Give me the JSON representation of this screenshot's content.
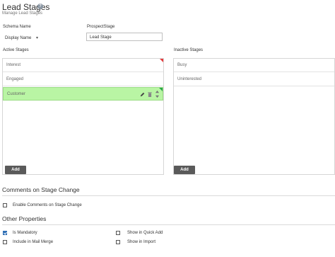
{
  "header": {
    "title": "Lead Stages",
    "subtitle": "Manage Lead Stages",
    "help_icon": "?"
  },
  "schema": {
    "label": "Schema Name",
    "value": "ProspectStage"
  },
  "display": {
    "label": "Display Name",
    "arrow": "▾",
    "value": "Lead Stage"
  },
  "active_stages": {
    "title": "Active Stages",
    "items": [
      {
        "label": "Interest"
      },
      {
        "label": "Engaged"
      },
      {
        "label": "Customer"
      }
    ],
    "add_label": "Add"
  },
  "inactive_stages": {
    "title": "Inactive Stages",
    "items": [
      {
        "label": "Busy"
      },
      {
        "label": "Uninterested"
      }
    ],
    "add_label": "Add"
  },
  "comments": {
    "title": "Comments on Stage Change",
    "checkbox_label": "Enable Comments on Stage Change",
    "checked": false
  },
  "other": {
    "title": "Other Properties",
    "options": [
      {
        "label": "Is Mandatory",
        "checked": true
      },
      {
        "label": "Include in Mail Merge",
        "checked": false
      },
      {
        "label": "Show in Quick Add",
        "checked": false
      },
      {
        "label": "Show in Import",
        "checked": false
      }
    ]
  },
  "colors": {
    "selected_row": "#b9f5a4",
    "button": "#5a5a5a",
    "corner_red": "#e5383b",
    "corner_green": "#2aa84a"
  }
}
